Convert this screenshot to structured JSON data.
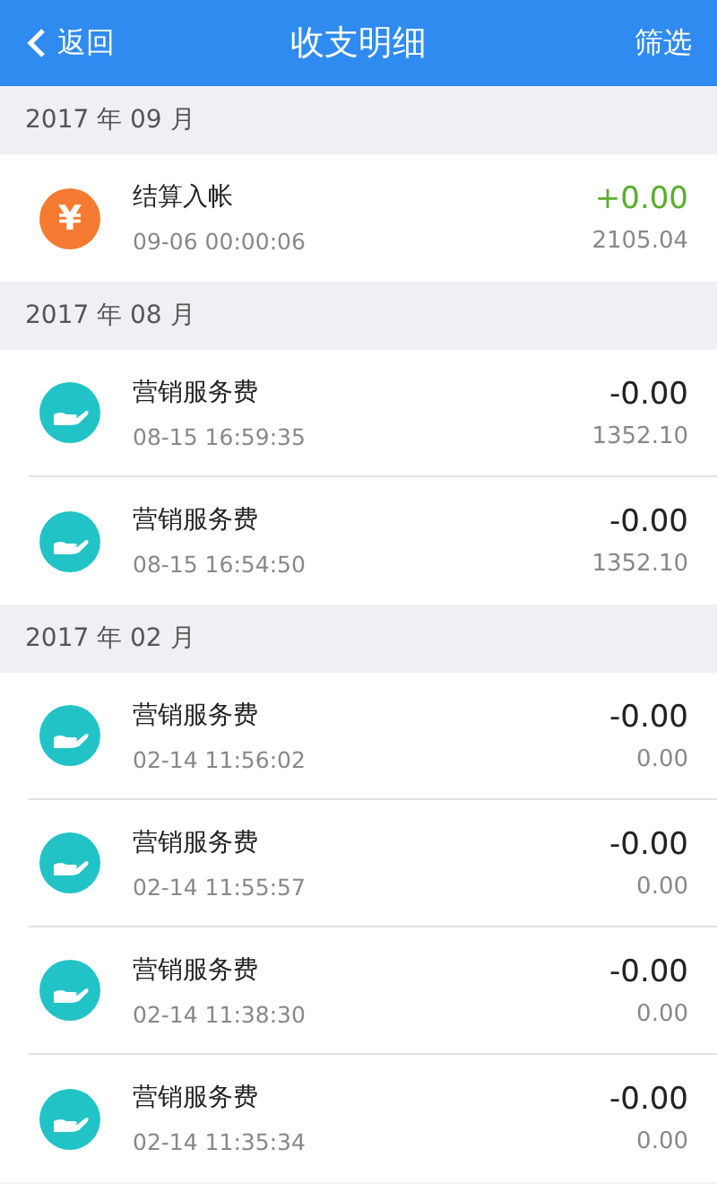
{
  "header": {
    "back": "返回",
    "title": "收支明细",
    "filter": "筛选"
  },
  "groups": [
    {
      "month": "2017 年 09 月",
      "items": [
        {
          "kind": "income",
          "symbol": "¥",
          "title": "结算入帐",
          "time": "09-06 00:00:06",
          "amount": "+0.00",
          "balance": "2105.04"
        }
      ]
    },
    {
      "month": "2017 年 08 月",
      "items": [
        {
          "kind": "expense",
          "title": "营销服务费",
          "time": "08-15 16:59:35",
          "amount": "-0.00",
          "balance": "1352.10"
        },
        {
          "kind": "expense",
          "title": "营销服务费",
          "time": "08-15 16:54:50",
          "amount": "-0.00",
          "balance": "1352.10"
        }
      ]
    },
    {
      "month": "2017 年 02 月",
      "items": [
        {
          "kind": "expense",
          "title": "营销服务费",
          "time": "02-14 11:56:02",
          "amount": "-0.00",
          "balance": "0.00"
        },
        {
          "kind": "expense",
          "title": "营销服务费",
          "time": "02-14 11:55:57",
          "amount": "-0.00",
          "balance": "0.00"
        },
        {
          "kind": "expense",
          "title": "营销服务费",
          "time": "02-14 11:38:30",
          "amount": "-0.00",
          "balance": "0.00"
        },
        {
          "kind": "expense",
          "title": "营销服务费",
          "time": "02-14 11:35:34",
          "amount": "-0.00",
          "balance": "0.00"
        }
      ]
    }
  ]
}
